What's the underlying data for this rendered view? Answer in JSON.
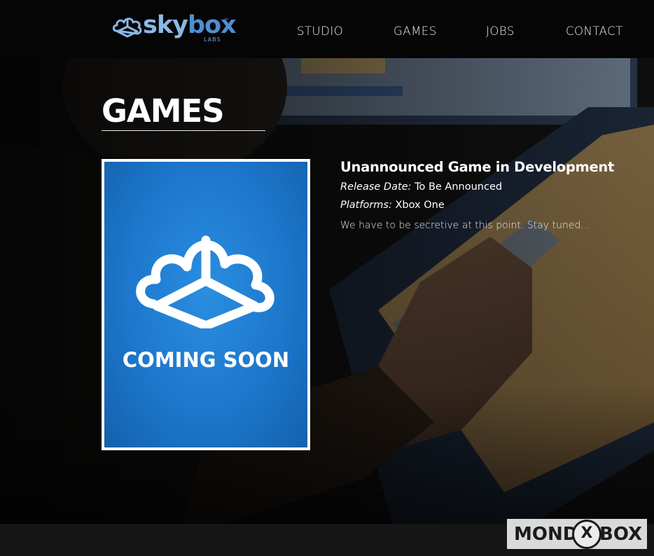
{
  "brand": {
    "name_part1": "sky",
    "name_part2": "box",
    "trademark": "™",
    "subtitle": "LABS",
    "colors": {
      "light": "#8ab9e6",
      "dark": "#4f8fd0"
    }
  },
  "nav": {
    "items": [
      {
        "label": "STUDIO"
      },
      {
        "label": "GAMES"
      },
      {
        "label": "JOBS"
      },
      {
        "label": "CONTACT"
      }
    ]
  },
  "page": {
    "title": "GAMES"
  },
  "game": {
    "poster_text": "COMING SOON",
    "poster_color": "#1d77cc",
    "title": "Unannounced Game in Development",
    "release_label": "Release Date:",
    "release_value": "To Be Announced",
    "platforms_label": "Platforms:",
    "platforms_value": "Xbox One",
    "description": "We have to be secretive at this point. Stay tuned…"
  },
  "watermark": {
    "left": "MOND",
    "middle": "X",
    "right": "BOX"
  }
}
